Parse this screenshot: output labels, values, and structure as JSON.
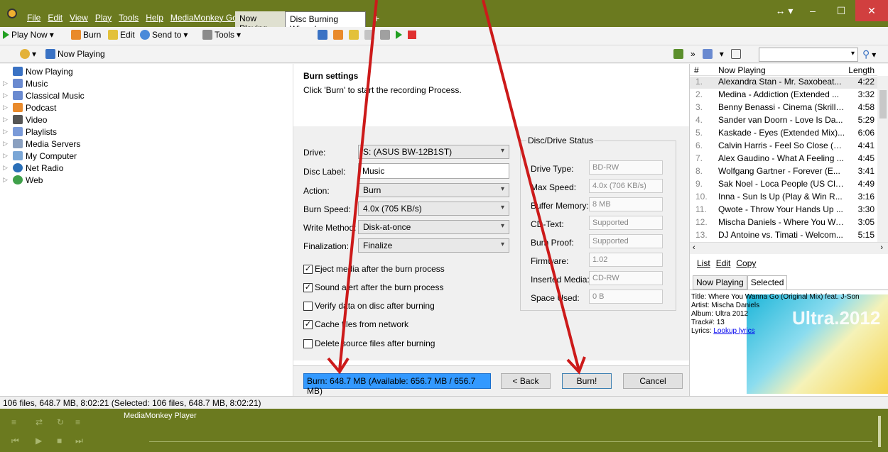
{
  "menu": [
    "File",
    "Edit",
    "View",
    "Play",
    "Tools",
    "Help",
    "MediaMonkey Gold"
  ],
  "tabs": [
    "Now Playing",
    "Disc Burning Wizard",
    "+"
  ],
  "toolbar": {
    "play": "Play Now",
    "burn": "Burn",
    "edit": "Edit",
    "send": "Send to",
    "tools": "Tools"
  },
  "breadcrumb": "Now Playing",
  "tree": [
    "Now Playing",
    "Music",
    "Classical Music",
    "Podcast",
    "Video",
    "Playlists",
    "Media Servers",
    "My Computer",
    "Net Radio",
    "Web"
  ],
  "wizard": {
    "title": "Burn settings",
    "subtitle": "Click 'Burn' to start the recording Process.",
    "fields": {
      "drive_label": "Drive:",
      "drive_value": "S: (ASUS BW-12B1ST)",
      "disc_label": "Disc Label:",
      "disc_value": "Music",
      "action_label": "Action:",
      "action_value": "Burn",
      "speed_label": "Burn Speed:",
      "speed_value": "4.0x (705 KB/s)",
      "method_label": "Write Method:",
      "method_value": "Disk-at-once",
      "final_label": "Finalization:",
      "final_value": "Finalize"
    },
    "checks": [
      {
        "label": "Eject media after the burn process",
        "checked": true
      },
      {
        "label": "Sound alert after the burn process",
        "checked": true
      },
      {
        "label": "Verify data on disc after burning",
        "checked": false
      },
      {
        "label": "Cache files from network",
        "checked": true
      },
      {
        "label": "Delete source files after burning",
        "checked": false
      }
    ],
    "status": {
      "legend": "Disc/Drive Status",
      "drive_type_label": "Drive Type:",
      "drive_type": "BD-RW",
      "max_speed_label": "Max Speed:",
      "max_speed": "4.0x (706 KB/s)",
      "buffer_label": "Buffer Memory:",
      "buffer": "8 MB",
      "cdtext_label": "CD-Text:",
      "cdtext": "Supported",
      "burnproof_label": "Burn Proof:",
      "burnproof": "Supported",
      "firmware_label": "Firmware:",
      "firmware": "1.02",
      "media_label": "Inserted Media:",
      "media": "CD-RW",
      "space_label": "Space Used:",
      "space": "0 B"
    },
    "burn_size": "Burn: 648.7 MB (Available: 656.7 MB / 656.7 MB)",
    "back": "< Back",
    "burn": "Burn!",
    "cancel": "Cancel"
  },
  "playlist": {
    "header_num": "#",
    "header_title": "Now Playing",
    "header_len": "Length",
    "rows": [
      {
        "n": "1.",
        "t": "Alexandra Stan - Mr. Saxobeat...",
        "l": "4:22"
      },
      {
        "n": "2.",
        "t": "Medina - Addiction (Extended ...",
        "l": "3:32"
      },
      {
        "n": "3.",
        "t": "Benny Benassi - Cinema (Skrille...",
        "l": "4:58"
      },
      {
        "n": "4.",
        "t": "Sander van Doorn - Love Is Da...",
        "l": "5:29"
      },
      {
        "n": "5.",
        "t": "Kaskade - Eyes (Extended Mix)...",
        "l": "6:06"
      },
      {
        "n": "6.",
        "t": "Calvin Harris - Feel So Close (E...",
        "l": "4:41"
      },
      {
        "n": "7.",
        "t": "Alex Gaudino - What A Feeling ...",
        "l": "4:45"
      },
      {
        "n": "8.",
        "t": "Wolfgang Gartner - Forever (E...",
        "l": "3:41"
      },
      {
        "n": "9.",
        "t": "Sak Noel - Loca People (US Cle...",
        "l": "4:49"
      },
      {
        "n": "10.",
        "t": "Inna - Sun Is Up (Play & Win R...",
        "l": "3:16"
      },
      {
        "n": "11.",
        "t": "Qwote - Throw Your Hands Up ...",
        "l": "3:30"
      },
      {
        "n": "12.",
        "t": "Mischa Daniels - Where You Wa...",
        "l": "3:05"
      },
      {
        "n": "13.",
        "t": "DJ Antoine vs. Timati - Welcom...",
        "l": "5:15"
      }
    ],
    "menu": [
      "List",
      "Edit",
      "Copy"
    ],
    "info_tabs": [
      "Now Playing",
      "Selected"
    ],
    "info": {
      "title": "Title: Where You Wanna Go (Original Mix) feat. J-Son",
      "artist": "Artist: Mischa Daniels",
      "album": "Album: Ultra 2012",
      "track": "Track#: 13",
      "lyrics_label": "Lyrics:",
      "lyrics_link": "Lookup lyrics",
      "cover_text": "Ultra.2012"
    }
  },
  "statusbar": "106 files, 648.7 MB, 8:02:21 (Selected: 106 files, 648.7 MB, 8:02:21)",
  "player": {
    "title": "MediaMonkey Player"
  },
  "colors": {
    "frame": "#6b7a1f",
    "arrow": "#cc1a1a",
    "burn_bar": "#3399ff"
  }
}
